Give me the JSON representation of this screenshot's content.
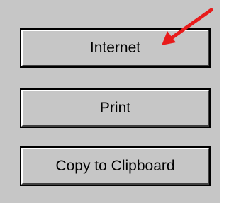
{
  "buttons": {
    "internet_label": "Internet",
    "print_label": "Print",
    "copy_label": "Copy to Clipboard"
  },
  "colors": {
    "panel": "#c6c6c6",
    "arrow": "#e81b1b"
  },
  "annotation": {
    "icon": "red-arrow-icon"
  }
}
